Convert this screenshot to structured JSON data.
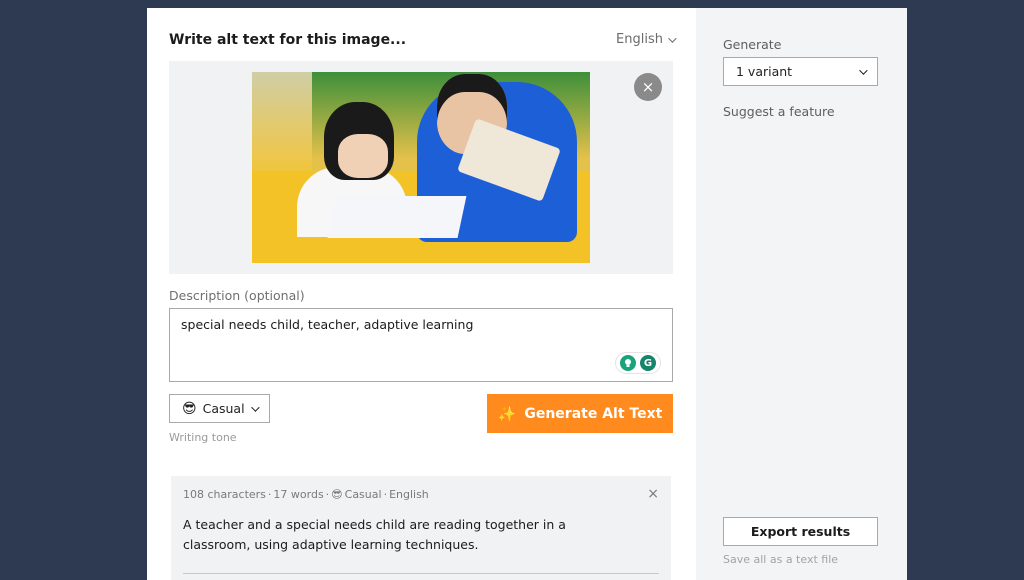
{
  "main": {
    "title": "Write alt text for this image...",
    "language": "English",
    "remove_icon": "×",
    "description_label": "Description (optional)",
    "description_value": "special needs child, teacher, adaptive learning",
    "assist_icons": [
      "lightbulb-icon",
      "grammarly-icon"
    ],
    "grammarly_glyph": "G",
    "tone": {
      "emoji": "😎",
      "label": "Casual",
      "caption": "Writing tone"
    },
    "generate_button": {
      "icon": "✨",
      "label": "Generate Alt Text",
      "color": "#ff8a1e"
    }
  },
  "result": {
    "characters": "108 characters",
    "words": "17 words",
    "tone_emoji": "😎",
    "tone": "Casual",
    "language": "English",
    "separator": "·",
    "text": "A teacher and a special needs child are reading together in a classroom, using adaptive learning techniques.",
    "close_icon": "×"
  },
  "sidebar": {
    "generate_label": "Generate",
    "variant_value": "1 variant",
    "suggest_feature": "Suggest a feature",
    "export_button": "Export results",
    "export_caption": "Save all as a text file"
  }
}
